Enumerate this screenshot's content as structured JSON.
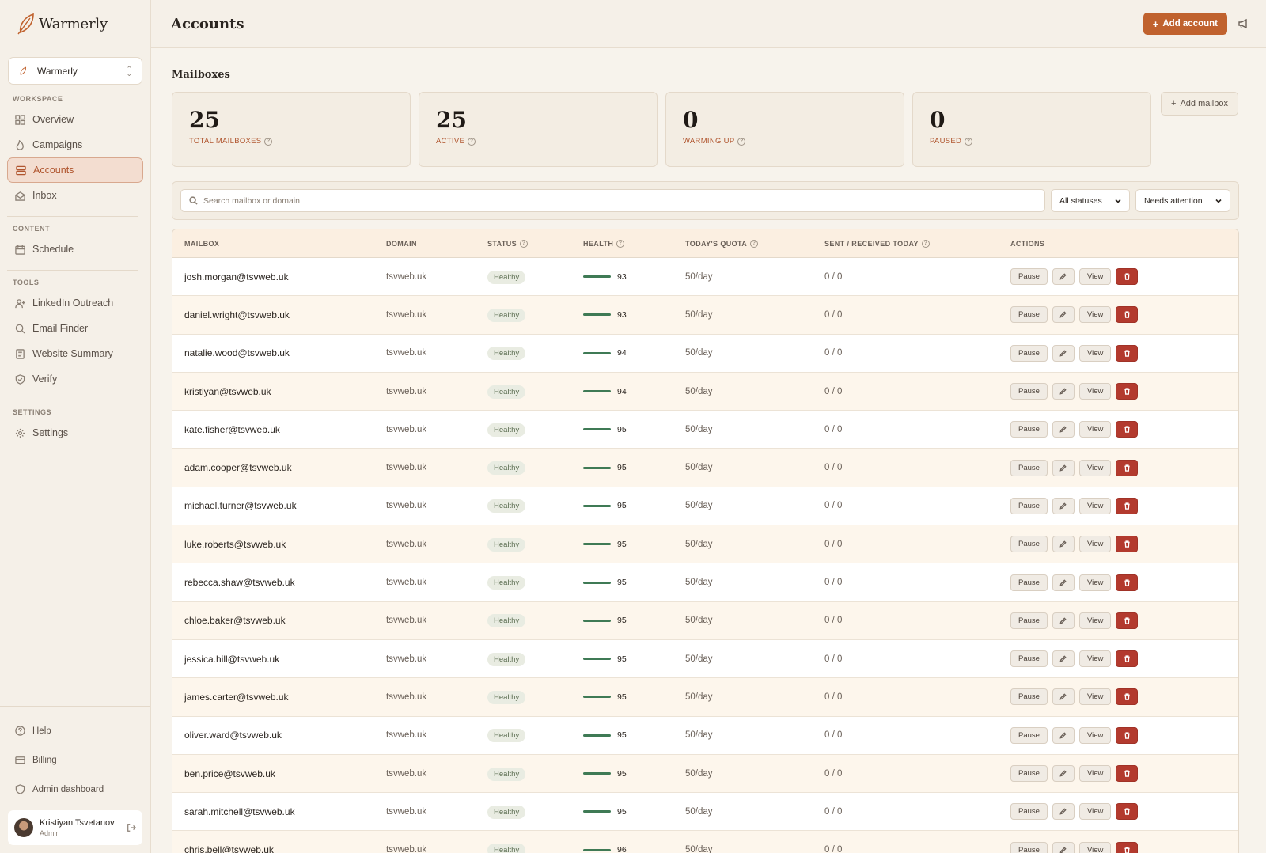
{
  "brand": {
    "name": "Warmerly",
    "accent": "#c0622e"
  },
  "workspace": {
    "name": "Warmerly"
  },
  "sidebar": {
    "sections": {
      "workspace": "WORKSPACE",
      "content": "CONTENT",
      "tools": "TOOLS",
      "settings": "SETTINGS"
    },
    "items": {
      "overview": "Overview",
      "campaigns": "Campaigns",
      "accounts": "Accounts",
      "inbox": "Inbox",
      "schedule": "Schedule",
      "linkedin": "LinkedIn Outreach",
      "email_finder": "Email Finder",
      "website_summary": "Website Summary",
      "verify": "Verify",
      "settings": "Settings"
    },
    "bottom": {
      "help": "Help",
      "billing": "Billing",
      "admin": "Admin dashboard"
    },
    "user": {
      "name": "Kristiyan Tsvetanov",
      "role": "Admin"
    }
  },
  "header": {
    "title": "Accounts",
    "add_account": "Add account"
  },
  "mailboxes": {
    "title": "Mailboxes",
    "add_mailbox": "Add mailbox",
    "stats": [
      {
        "value": "25",
        "label": "TOTAL MAILBOXES"
      },
      {
        "value": "25",
        "label": "ACTIVE"
      },
      {
        "value": "0",
        "label": "WARMING UP"
      },
      {
        "value": "0",
        "label": "PAUSED"
      }
    ]
  },
  "filters": {
    "search_placeholder": "Search mailbox or domain",
    "status": "All statuses",
    "sort": "Needs attention"
  },
  "table": {
    "columns": [
      "MAILBOX",
      "DOMAIN",
      "STATUS",
      "HEALTH",
      "TODAY'S QUOTA",
      "SENT / RECEIVED TODAY",
      "ACTIONS"
    ],
    "actions": {
      "pause": "Pause",
      "view": "View"
    },
    "rows": [
      {
        "mailbox": "josh.morgan@tsvweb.uk",
        "domain": "tsvweb.uk",
        "status": "Healthy",
        "health": "93",
        "quota": "50/day",
        "sent": "0 / 0"
      },
      {
        "mailbox": "daniel.wright@tsvweb.uk",
        "domain": "tsvweb.uk",
        "status": "Healthy",
        "health": "93",
        "quota": "50/day",
        "sent": "0 / 0"
      },
      {
        "mailbox": "natalie.wood@tsvweb.uk",
        "domain": "tsvweb.uk",
        "status": "Healthy",
        "health": "94",
        "quota": "50/day",
        "sent": "0 / 0"
      },
      {
        "mailbox": "kristiyan@tsvweb.uk",
        "domain": "tsvweb.uk",
        "status": "Healthy",
        "health": "94",
        "quota": "50/day",
        "sent": "0 / 0"
      },
      {
        "mailbox": "kate.fisher@tsvweb.uk",
        "domain": "tsvweb.uk",
        "status": "Healthy",
        "health": "95",
        "quota": "50/day",
        "sent": "0 / 0"
      },
      {
        "mailbox": "adam.cooper@tsvweb.uk",
        "domain": "tsvweb.uk",
        "status": "Healthy",
        "health": "95",
        "quota": "50/day",
        "sent": "0 / 0"
      },
      {
        "mailbox": "michael.turner@tsvweb.uk",
        "domain": "tsvweb.uk",
        "status": "Healthy",
        "health": "95",
        "quota": "50/day",
        "sent": "0 / 0"
      },
      {
        "mailbox": "luke.roberts@tsvweb.uk",
        "domain": "tsvweb.uk",
        "status": "Healthy",
        "health": "95",
        "quota": "50/day",
        "sent": "0 / 0"
      },
      {
        "mailbox": "rebecca.shaw@tsvweb.uk",
        "domain": "tsvweb.uk",
        "status": "Healthy",
        "health": "95",
        "quota": "50/day",
        "sent": "0 / 0"
      },
      {
        "mailbox": "chloe.baker@tsvweb.uk",
        "domain": "tsvweb.uk",
        "status": "Healthy",
        "health": "95",
        "quota": "50/day",
        "sent": "0 / 0"
      },
      {
        "mailbox": "jessica.hill@tsvweb.uk",
        "domain": "tsvweb.uk",
        "status": "Healthy",
        "health": "95",
        "quota": "50/day",
        "sent": "0 / 0"
      },
      {
        "mailbox": "james.carter@tsvweb.uk",
        "domain": "tsvweb.uk",
        "status": "Healthy",
        "health": "95",
        "quota": "50/day",
        "sent": "0 / 0"
      },
      {
        "mailbox": "oliver.ward@tsvweb.uk",
        "domain": "tsvweb.uk",
        "status": "Healthy",
        "health": "95",
        "quota": "50/day",
        "sent": "0 / 0"
      },
      {
        "mailbox": "ben.price@tsvweb.uk",
        "domain": "tsvweb.uk",
        "status": "Healthy",
        "health": "95",
        "quota": "50/day",
        "sent": "0 / 0"
      },
      {
        "mailbox": "sarah.mitchell@tsvweb.uk",
        "domain": "tsvweb.uk",
        "status": "Healthy",
        "health": "95",
        "quota": "50/day",
        "sent": "0 / 0"
      },
      {
        "mailbox": "chris.bell@tsvweb.uk",
        "domain": "tsvweb.uk",
        "status": "Healthy",
        "health": "96",
        "quota": "50/day",
        "sent": "0 / 0"
      }
    ]
  }
}
